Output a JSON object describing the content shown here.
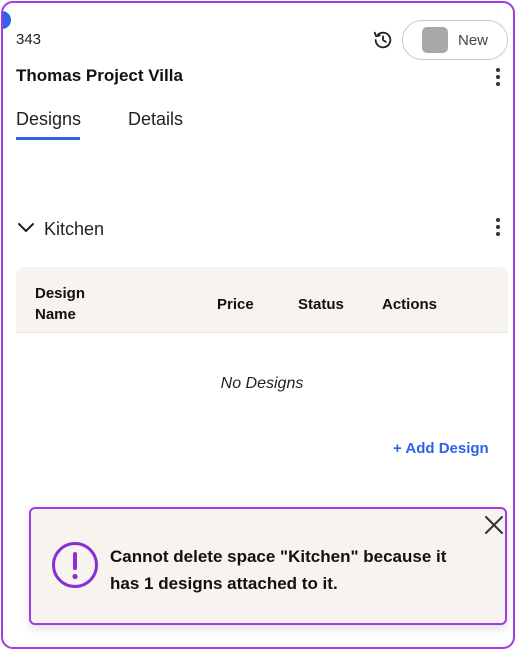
{
  "project": {
    "id": "343",
    "title": "Thomas Project Villa",
    "status_label": "New"
  },
  "tabs": [
    {
      "label": "Designs",
      "active": true
    },
    {
      "label": "Details",
      "active": false
    }
  ],
  "section": {
    "name": "Kitchen",
    "expanded": true
  },
  "table": {
    "columns": [
      "Design Name",
      "Price",
      "Status",
      "Actions"
    ],
    "rows": [],
    "empty_text": "No Designs"
  },
  "add_design_label": "+ Add Design",
  "toast": {
    "message": "Cannot delete space \"Kitchen\" because it has 1 designs attached to it."
  },
  "colors": {
    "accent": "#2f62e8",
    "frame_border": "#a33be0",
    "header_bg": "#f7f3ef",
    "status_swatch": "#a8a8a8"
  }
}
